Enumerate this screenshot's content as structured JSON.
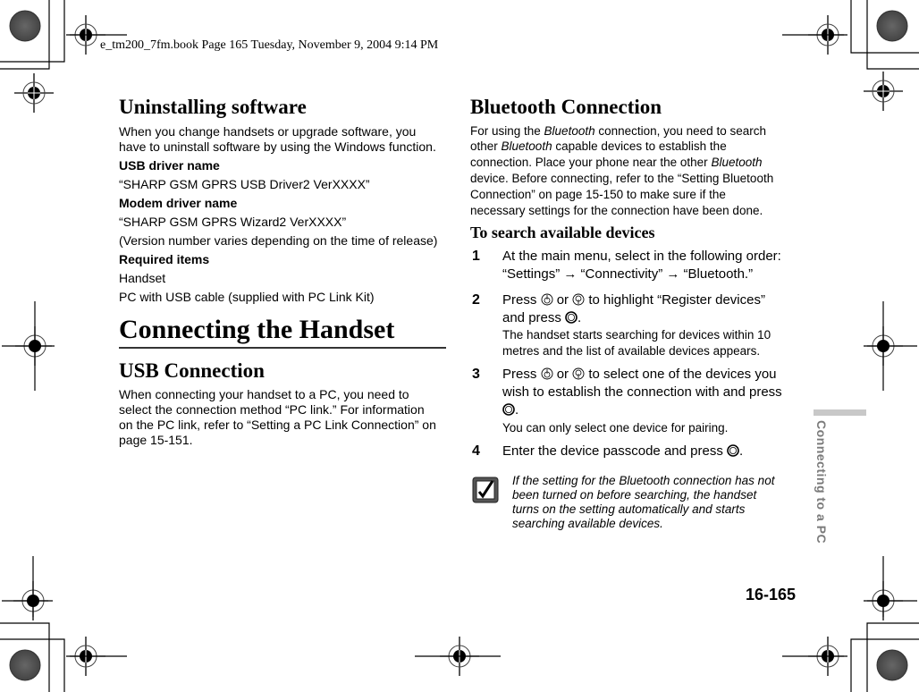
{
  "print_header": "e_tm200_7fm.book  Page 165  Tuesday, November 9, 2004  9:14 PM",
  "left_column": {
    "uninstall": {
      "title": "Uninstalling software",
      "intro_lines": [
        "When you change handsets or upgrade software, you",
        "have to uninstall software by using the Windows function."
      ],
      "usb_driver_label": "USB driver name",
      "usb_driver_value": "“SHARP GSM GPRS USB Driver2 VerXXXX”",
      "modem_driver_label": "Modem driver name",
      "modem_driver_value": "“SHARP GSM GPRS Wizard2 VerXXXX”",
      "version_note": "(Version number varies depending on the time of release)",
      "required_label": "Required items",
      "required_items": [
        "Handset",
        "PC with USB cable (supplied with PC Link Kit)"
      ]
    },
    "section_title": "Connecting the Handset",
    "usb_connection": {
      "title": "USB Connection",
      "lines": [
        "When connecting your handset to a PC, you need to",
        "select the connection method “PC link.” For information",
        "on the PC link, refer to “Setting a PC Link Connection” on",
        "page 15-151."
      ]
    }
  },
  "right_column": {
    "bluetooth": {
      "title": "Bluetooth Connection",
      "line1_pre": "For using the ",
      "line1_em": "Bluetooth",
      "line1_post": " connection, you need to search",
      "line2_pre": "other ",
      "line2_em": "Bluetooth",
      "line2_post": " capable devices to establish the",
      "line3_pre": "connection. Place your phone near the other ",
      "line3_em": "Bluetooth",
      "line4": "device. Before connecting, refer to the “Setting Bluetooth",
      "line5": "Connection” on page 15-150 to make sure if the",
      "line6": "necessary settings for the connection have been done."
    },
    "search": {
      "title": "To search available devices",
      "steps": [
        {
          "num": "1",
          "line1": "At the main menu, select in the following order:",
          "line2": "“Settings” → “Connectivity” → “Bluetooth.”"
        },
        {
          "num": "2",
          "press": "Press",
          "or": "or",
          "line1_post": "to highlight “Register devices”",
          "line2_pre": "and press",
          "line2_post": ".",
          "sub1": "The handset starts searching for devices within 10",
          "sub2": "metres and the list of available devices appears."
        },
        {
          "num": "3",
          "press": "Press",
          "or": "or",
          "line1_post": "to select one of the devices you",
          "line2": "wish to establish the connection with and press",
          "line3_post": ".",
          "sub1": "You can only select one device for pairing."
        },
        {
          "num": "4",
          "line1_pre": "Enter the device passcode and press",
          "line1_post": "."
        }
      ]
    },
    "note": {
      "icon": "checkmark-note-icon",
      "lines": [
        "If the setting for the Bluetooth connection has not",
        "been turned on before searching, the handset",
        "turns on the setting automatically and starts",
        "searching available devices."
      ]
    }
  },
  "side_tab": "Connecting to a PC",
  "page_number": "16-165",
  "icons": {
    "nav_up": "nav-key-up-icon",
    "nav_down": "nav-key-down-icon",
    "center": "center-key-icon"
  }
}
